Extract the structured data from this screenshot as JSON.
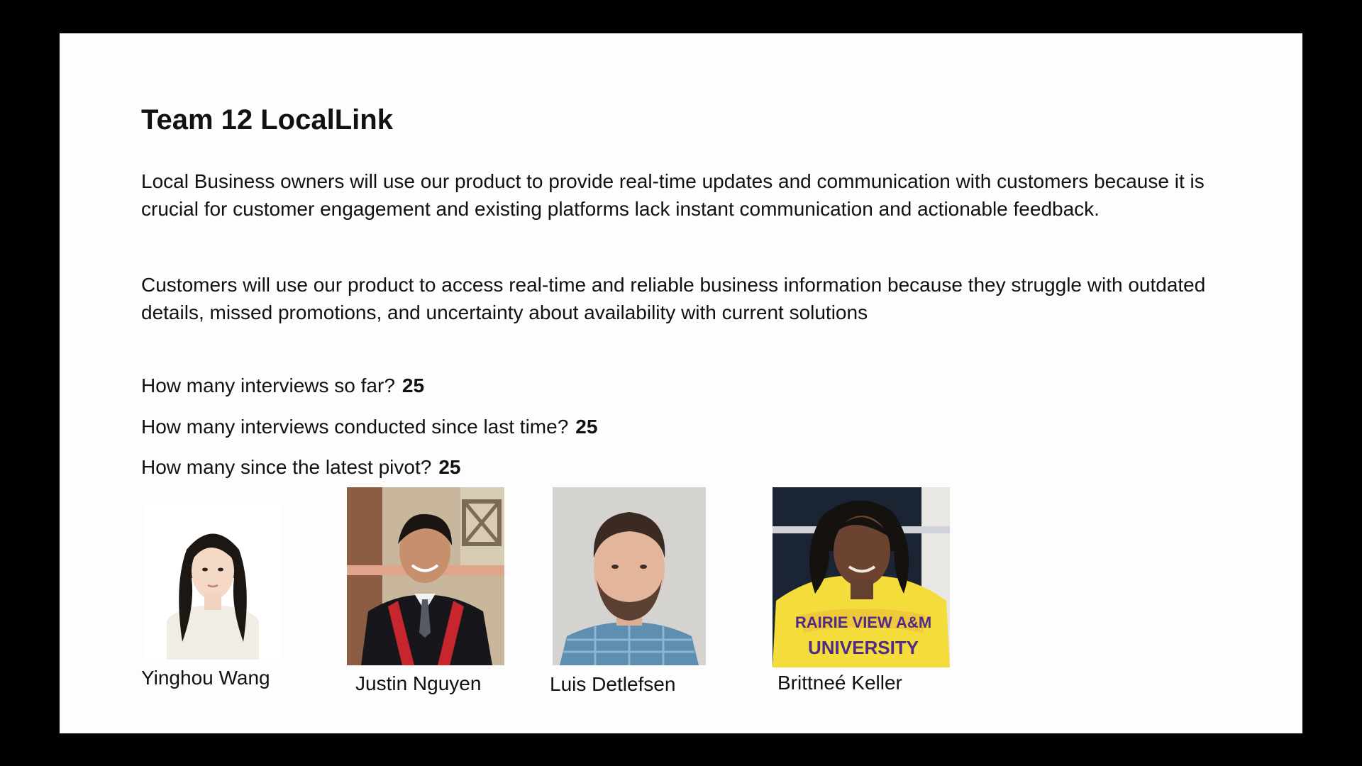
{
  "slide": {
    "title": "Team 12 LocalLink",
    "paragraphs": [
      "Local Business owners will use our product to provide real-time updates and communication with customers because it is crucial for customer engagement and existing platforms lack instant communication and actionable feedback.",
      "Customers will use our product to access real-time and reliable business information because they struggle with outdated details, missed promotions, and uncertainty about availability with current solutions"
    ],
    "questions": [
      {
        "label": "How many interviews so far?",
        "value": "25"
      },
      {
        "label": "How many interviews conducted since last time?",
        "value": "25"
      },
      {
        "label": "How many since the latest pivot?",
        "value": "25"
      }
    ],
    "team": [
      {
        "name": "Yinghou Wang",
        "photo": "person-photo"
      },
      {
        "name": "Justin Nguyen",
        "photo": "person-photo"
      },
      {
        "name": "Luis Detlefsen",
        "photo": "person-photo"
      },
      {
        "name": "Brittneé Keller",
        "photo": "person-photo"
      }
    ],
    "photo_shirt_text": [
      "RAIRIE VIEW A&M",
      "UNIVERSITY"
    ]
  },
  "colors": {
    "background": "#000000",
    "slide": "#fdfdfd",
    "text": "#111111"
  }
}
